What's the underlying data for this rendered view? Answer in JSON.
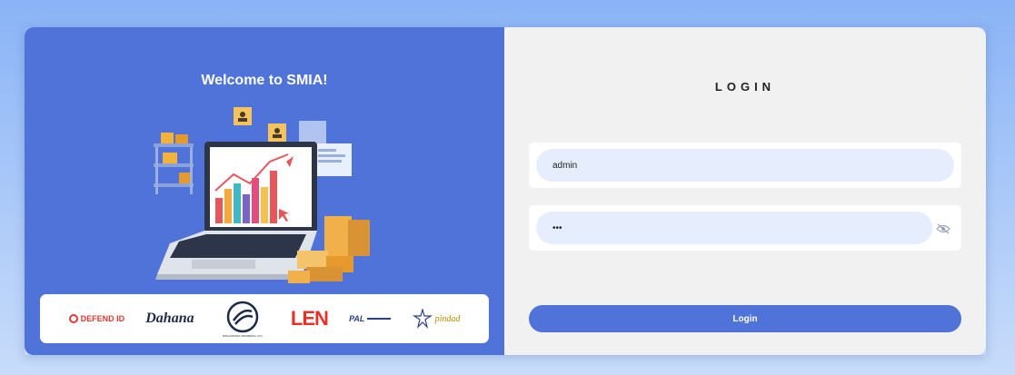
{
  "left_panel": {
    "welcome_text": "Welcome to SMIA!",
    "partners": [
      {
        "icon": "defend-id-logo",
        "text": "DEFEND ID"
      },
      {
        "icon": "dahana-logo",
        "text": "Dahana"
      },
      {
        "icon": "dirgantara-logo",
        "text": "DIRGANTARA INDONESIA (DI)"
      },
      {
        "icon": "len-logo",
        "text": "LEN"
      },
      {
        "icon": "pal-logo",
        "text": "PAL"
      },
      {
        "icon": "pindad-logo",
        "text": "pindad"
      }
    ]
  },
  "login_form": {
    "title": "LOGIN",
    "username_value": "admin",
    "password_value": "•••",
    "password_toggle_icon": "eye-slash-icon",
    "submit_label": "Login"
  },
  "colors": {
    "primary": "#4f73d9",
    "field_bg": "#e6eefd",
    "panel_bg": "#f1f1f2"
  }
}
